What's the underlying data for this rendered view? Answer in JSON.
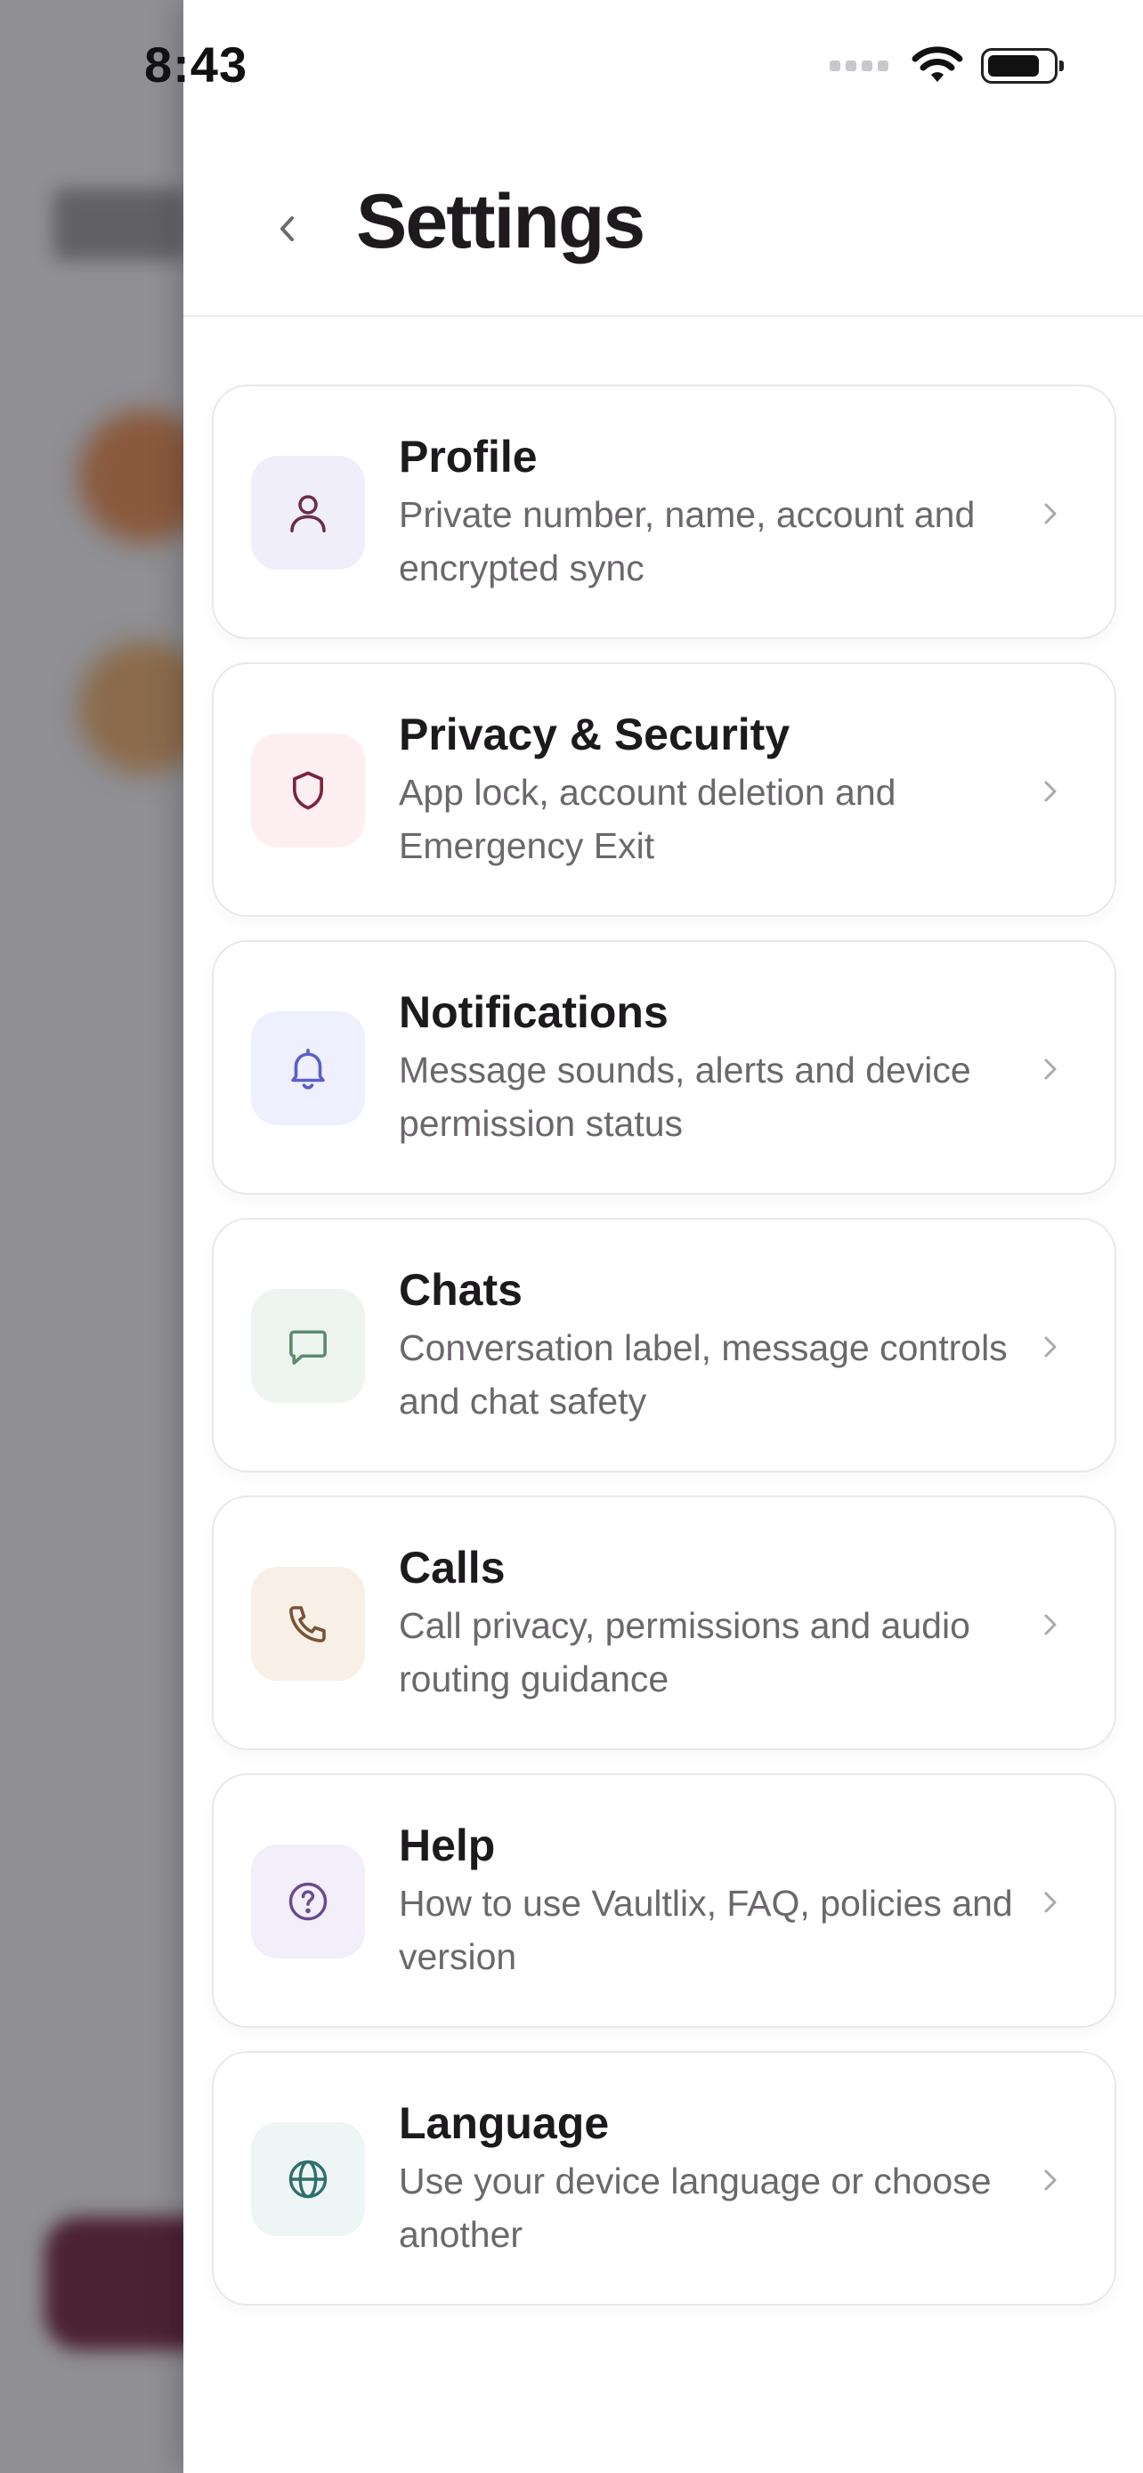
{
  "status_bar": {
    "time": "8:43"
  },
  "header": {
    "title": "Settings"
  },
  "colors": {
    "accent": "#6b2d47",
    "panel_bg": "#ffffff",
    "desc_text": "#6c676d"
  },
  "items": [
    {
      "title": "Profile",
      "description": "Private number, name, account and encrypted sync",
      "icon": "person-icon",
      "tile_color": "#f1eefc",
      "icon_color": "#6b2d47"
    },
    {
      "title": "Privacy & Security",
      "description": "App lock, account deletion and Emergency Exit",
      "icon": "shield-icon",
      "tile_color": "#fdeff1",
      "icon_color": "#7a2340"
    },
    {
      "title": "Notifications",
      "description": "Message sounds, alerts and device permission status",
      "icon": "bell-icon",
      "tile_color": "#eef0fd",
      "icon_color": "#5b5fc7"
    },
    {
      "title": "Chats",
      "description": "Conversation label, message controls and chat safety",
      "icon": "chat-bubble-icon",
      "tile_color": "#eef5f0",
      "icon_color": "#5c8b6a"
    },
    {
      "title": "Calls",
      "description": "Call privacy, permissions and audio routing guidance",
      "icon": "phone-icon",
      "tile_color": "#f8efe7",
      "icon_color": "#7a5236"
    },
    {
      "title": "Help",
      "description": "How to use Vaultlix, FAQ, policies and version",
      "icon": "help-circle-icon",
      "tile_color": "#f2eefa",
      "icon_color": "#6b4a8c"
    },
    {
      "title": "Language",
      "description": "Use your device language or choose another",
      "icon": "globe-icon",
      "tile_color": "#eef5f5",
      "icon_color": "#2f6f6a"
    }
  ]
}
